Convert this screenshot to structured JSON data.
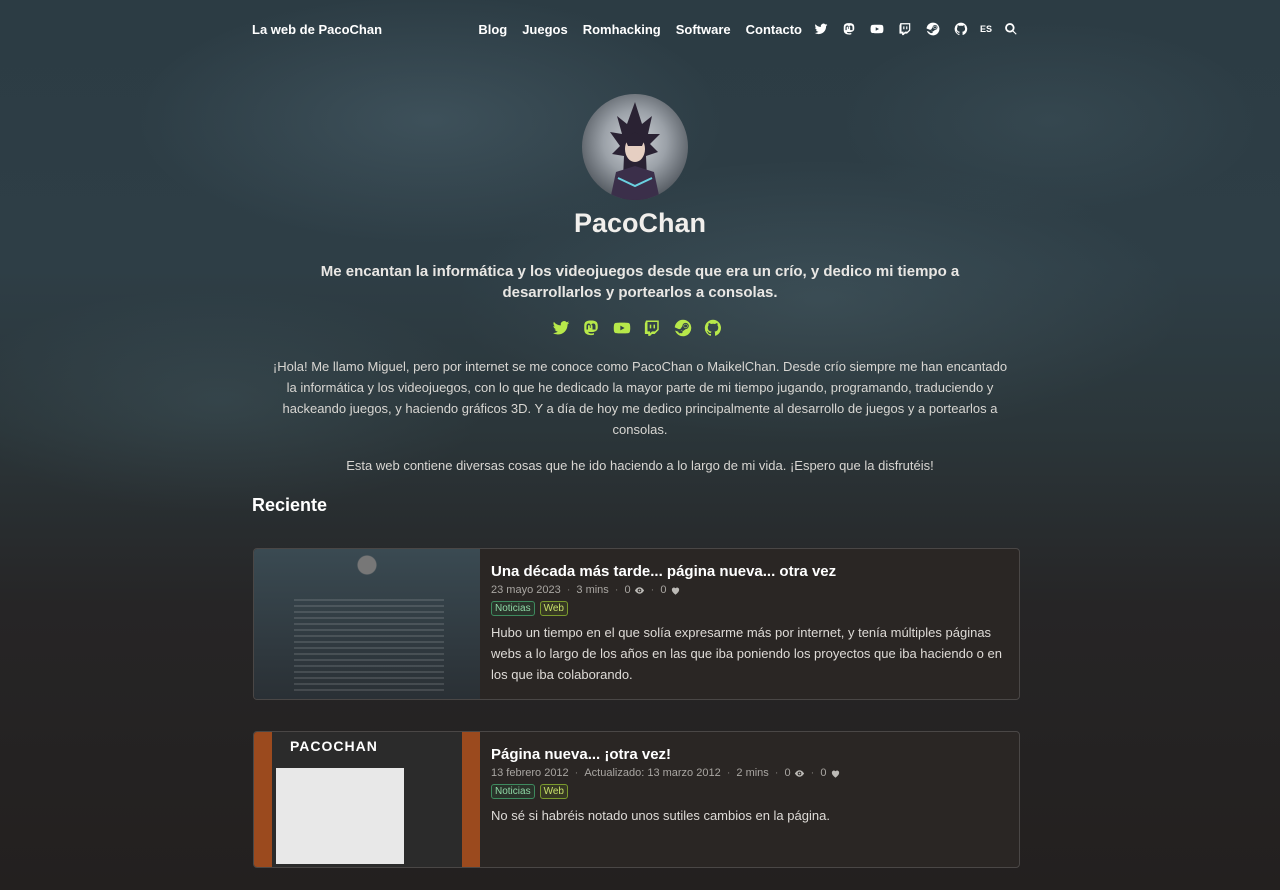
{
  "nav": {
    "brand": "La web de PacoChan",
    "links": [
      "Blog",
      "Juegos",
      "Romhacking",
      "Software",
      "Contacto"
    ],
    "icons": [
      "twitter-icon",
      "mastodon-icon",
      "youtube-icon",
      "twitch-icon",
      "steam-icon",
      "github-icon"
    ],
    "lang": "ES",
    "search_icon": "search-icon"
  },
  "hero": {
    "name": "PacoChan",
    "tagline": "Me encantan la informática y los videojuegos desde que era un crío, y dedico mi tiempo a desarrollarlos y portearlos a consolas.",
    "social_icons": [
      "twitter-icon",
      "mastodon-icon",
      "youtube-icon",
      "twitch-icon",
      "steam-icon",
      "github-icon"
    ],
    "social_color": "#b7e84a",
    "intro_1": "¡Hola! Me llamo Miguel, pero por internet se me conoce como PacoChan o MaikelChan. Desde crío siempre me han encantado la informática y los videojuegos, con lo que he dedicado la mayor parte de mi tiempo jugando, programando, traduciendo y hackeando juegos, y haciendo gráficos 3D. Y a día de hoy me dedico principalmente al desarrollo de juegos y a portearlos a consolas.",
    "intro_2": "Esta web contiene diversas cosas que he ido haciendo a lo largo de mi vida. ¡Espero que la disfrutéis!"
  },
  "recent": {
    "heading": "Reciente",
    "posts": [
      {
        "title": "Una década más tarde... página nueva... otra vez",
        "date": "23 mayo 2023",
        "updated": "",
        "read_time": "3 mins",
        "views": "0",
        "likes": "0",
        "tags": [
          "Noticias",
          "Web"
        ],
        "excerpt": "Hubo un tiempo en el que solía expresarme más por internet, y tenía múltiples páginas webs a lo largo de los años en las que iba poniendo los proyectos que iba haciendo o en los que iba colaborando."
      },
      {
        "title": "Página nueva... ¡otra vez!",
        "date": "13 febrero 2012",
        "updated": "Actualizado: 13 marzo 2012",
        "read_time": "2 mins",
        "views": "0",
        "likes": "0",
        "tags": [
          "Noticias",
          "Web"
        ],
        "excerpt": "No sé si habréis notado unos sutiles cambios en la página.",
        "thumb_title": "PACOCHAN"
      }
    ]
  }
}
